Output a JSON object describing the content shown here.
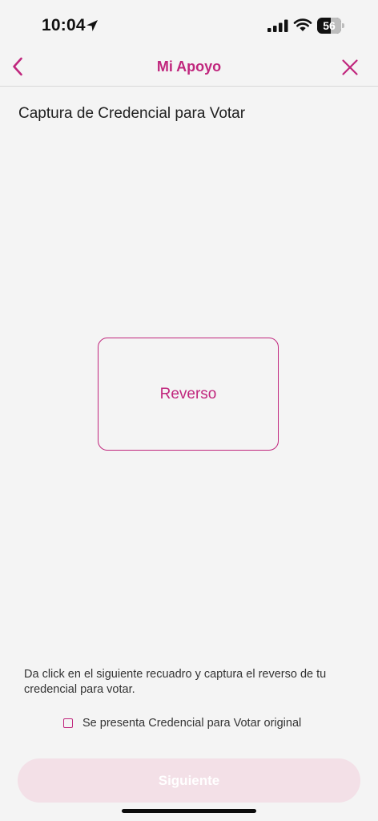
{
  "status_bar": {
    "time": "10:04",
    "battery_level": "56",
    "battery_fraction": 0.56,
    "icons": [
      "location-arrow-icon",
      "cellular-signal-icon",
      "wifi-icon",
      "battery-icon"
    ]
  },
  "nav": {
    "title": "Mi Apoyo",
    "back_icon": "chevron-left-icon",
    "close_icon": "close-icon"
  },
  "page": {
    "title": "Captura de Credencial para Votar"
  },
  "capture": {
    "label": "Reverso"
  },
  "instructions": {
    "text": "Da click en el siguiente recuadro y captura el reverso de tu credencial para votar."
  },
  "checkbox": {
    "label": "Se presenta Credencial para Votar original",
    "checked": false
  },
  "next_button": {
    "label": "Siguiente",
    "enabled": false
  },
  "colors": {
    "accent": "#c0267d",
    "background": "#f4f4f4",
    "button_disabled": "#f3e0e7"
  }
}
